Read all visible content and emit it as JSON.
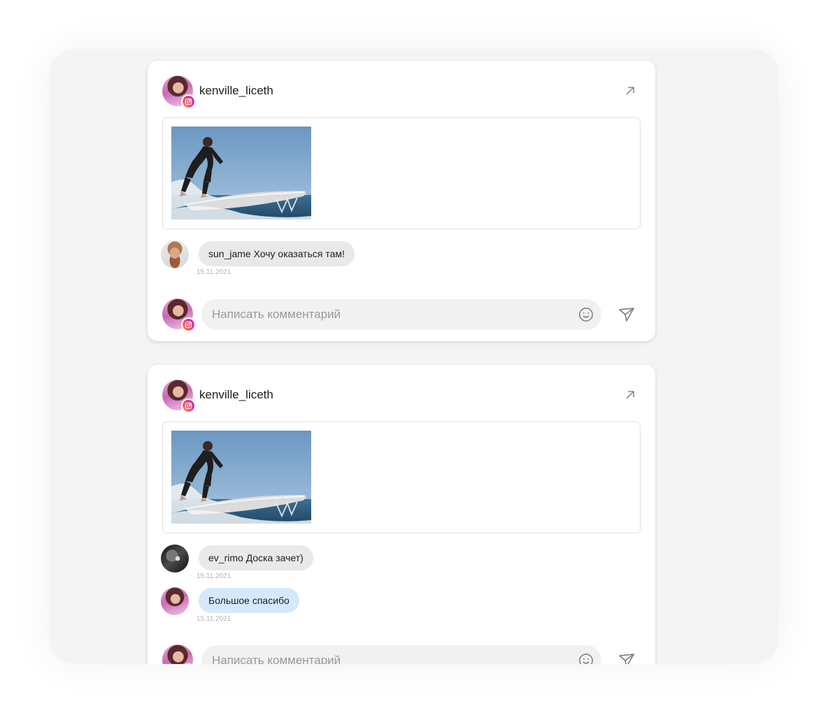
{
  "posts": [
    {
      "author": "kenville_liceth",
      "comments": [
        {
          "author": "sun_jame",
          "text": "Хочу оказаться там!",
          "date": "15.11.2021"
        }
      ],
      "composer_placeholder": "Написать комментарий"
    },
    {
      "author": "kenville_liceth",
      "comments": [
        {
          "author": "ev_rimo",
          "text": "Доска зачет)",
          "date": "15.11.2021"
        },
        {
          "author": "",
          "text": "Большое спасибо",
          "date": "15.11.2021"
        }
      ],
      "composer_placeholder": "Написать комментарий"
    }
  ],
  "icons": {
    "open": "arrow-up-right-icon",
    "emoji": "smile-icon",
    "send": "send-icon",
    "platform": "instagram-icon"
  },
  "colors": {
    "frame_bg": "#f4f4f4",
    "bubble": "#e9e9e9",
    "own_bubble": "#d4e9fb",
    "input_bg": "#f1f1f1"
  }
}
